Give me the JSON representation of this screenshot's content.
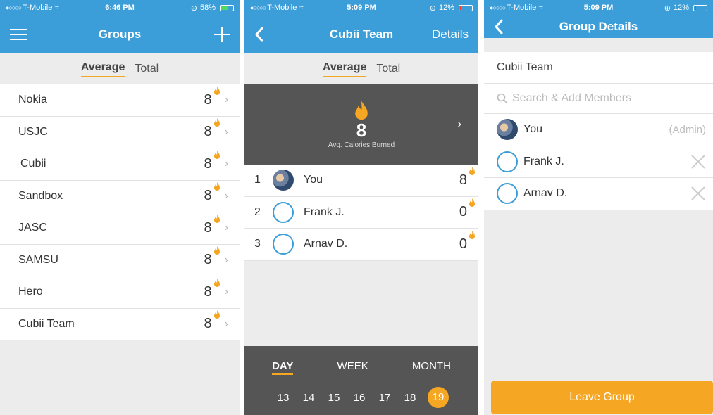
{
  "colors": {
    "primary": "#3c9ed8",
    "accent": "#f5a623",
    "dark_panel": "#555555"
  },
  "screen1": {
    "status": {
      "carrier": "T-Mobile",
      "time": "6:46 PM",
      "battery": "58%"
    },
    "nav": {
      "title": "Groups",
      "left_icon": "hamburger-menu-icon",
      "right_icon": "plus-icon"
    },
    "tabs": [
      {
        "label": "Average",
        "active": true
      },
      {
        "label": "Total",
        "active": false
      }
    ],
    "groups": [
      {
        "name": "Nokia",
        "score": "8"
      },
      {
        "name": "USJC",
        "score": "8"
      },
      {
        "name": "Cubii",
        "score": "8"
      },
      {
        "name": "Sandbox",
        "score": "8"
      },
      {
        "name": "JASC",
        "score": "8"
      },
      {
        "name": "SAMSU",
        "score": "8"
      },
      {
        "name": "Hero",
        "score": "8"
      },
      {
        "name": "Cubii Team",
        "score": "8"
      }
    ]
  },
  "screen2": {
    "status": {
      "carrier": "T-Mobile",
      "time": "5:09 PM",
      "battery": "12%"
    },
    "nav": {
      "title": "Cubii Team",
      "back_icon": "back-chevron-icon",
      "right_label": "Details"
    },
    "tabs": [
      {
        "label": "Average",
        "active": true
      },
      {
        "label": "Total",
        "active": false
      }
    ],
    "summary": {
      "value": "8",
      "label": "Avg. Calories Burned",
      "icon": "flame-icon"
    },
    "members": [
      {
        "rank": "1",
        "name": "You",
        "score": "8",
        "avatar": "photo"
      },
      {
        "rank": "2",
        "name": "Frank J.",
        "score": "0",
        "avatar": "empty"
      },
      {
        "rank": "3",
        "name": "Arnav D.",
        "score": "0",
        "avatar": "empty"
      }
    ],
    "periods": [
      {
        "label": "DAY",
        "active": true
      },
      {
        "label": "WEEK",
        "active": false
      },
      {
        "label": "MONTH",
        "active": false
      }
    ],
    "dates": [
      {
        "label": "13",
        "active": false
      },
      {
        "label": "14",
        "active": false
      },
      {
        "label": "15",
        "active": false
      },
      {
        "label": "16",
        "active": false
      },
      {
        "label": "17",
        "active": false
      },
      {
        "label": "18",
        "active": false
      },
      {
        "label": "19",
        "active": true
      }
    ]
  },
  "screen3": {
    "status": {
      "carrier": "T-Mobile",
      "time": "5:09 PM",
      "battery": "12%"
    },
    "nav": {
      "title": "Group Details",
      "back_icon": "back-chevron-icon"
    },
    "group_name": "Cubii Team",
    "search_placeholder": "Search & Add Members",
    "members": [
      {
        "name": "You",
        "role": "(Admin)",
        "avatar": "photo"
      },
      {
        "name": "Frank J.",
        "avatar": "empty",
        "action_icon": "remove-x-icon"
      },
      {
        "name": "Arnav D.",
        "avatar": "empty",
        "action_icon": "remove-x-icon"
      }
    ],
    "leave_button": "Leave Group"
  }
}
